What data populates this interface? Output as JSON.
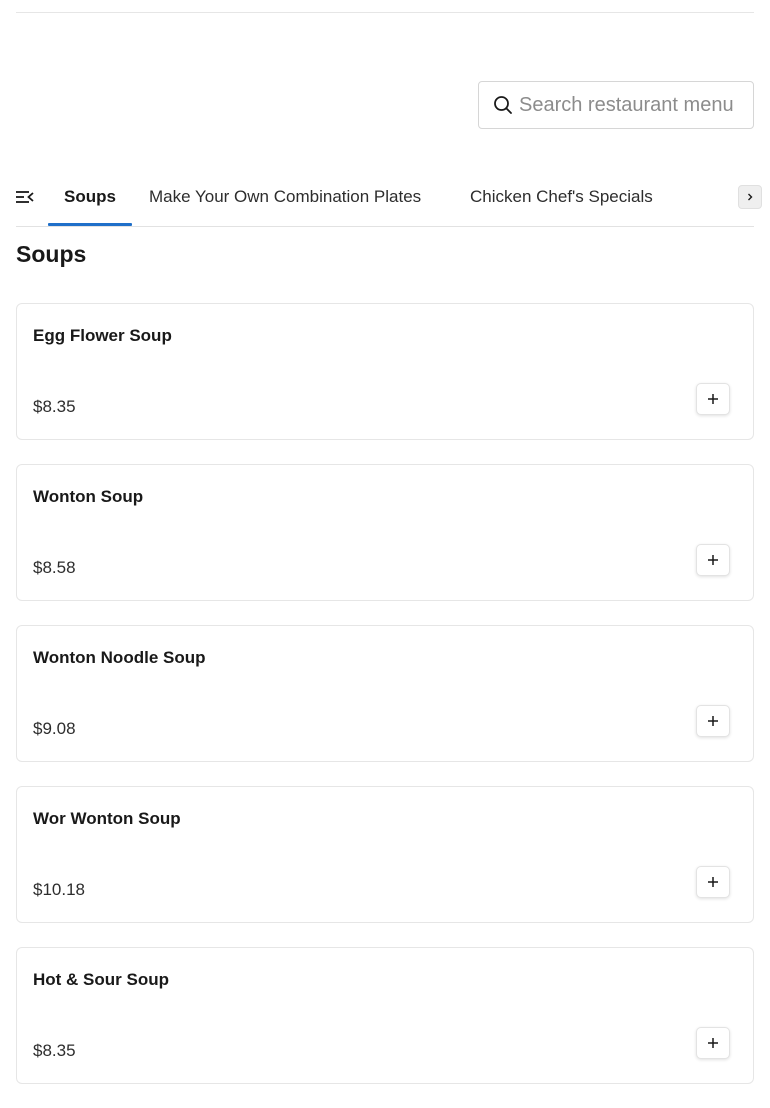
{
  "search": {
    "placeholder": "Search restaurant menu",
    "value": ""
  },
  "nav": {
    "tabs": [
      {
        "label": "Soups",
        "active": true
      },
      {
        "label": "Make Your Own Combination Plates",
        "active": false
      },
      {
        "label": "Chicken Chef's Specials",
        "active": false
      }
    ]
  },
  "section": {
    "title": "Soups",
    "items": [
      {
        "name": "Egg Flower Soup",
        "price": "$8.35"
      },
      {
        "name": "Wonton Soup",
        "price": "$8.58"
      },
      {
        "name": "Wonton Noodle Soup",
        "price": "$9.08"
      },
      {
        "name": "Wor Wonton Soup",
        "price": "$10.18"
      },
      {
        "name": "Hot & Sour Soup",
        "price": "$8.35"
      }
    ]
  },
  "colors": {
    "accent": "#1f6fc9",
    "border": "#e6e6e6",
    "text": "#191919"
  },
  "icons": {
    "search": "search-icon",
    "menu": "menu-list-icon",
    "scroll": "chevron-right-icon",
    "add": "plus-icon"
  }
}
